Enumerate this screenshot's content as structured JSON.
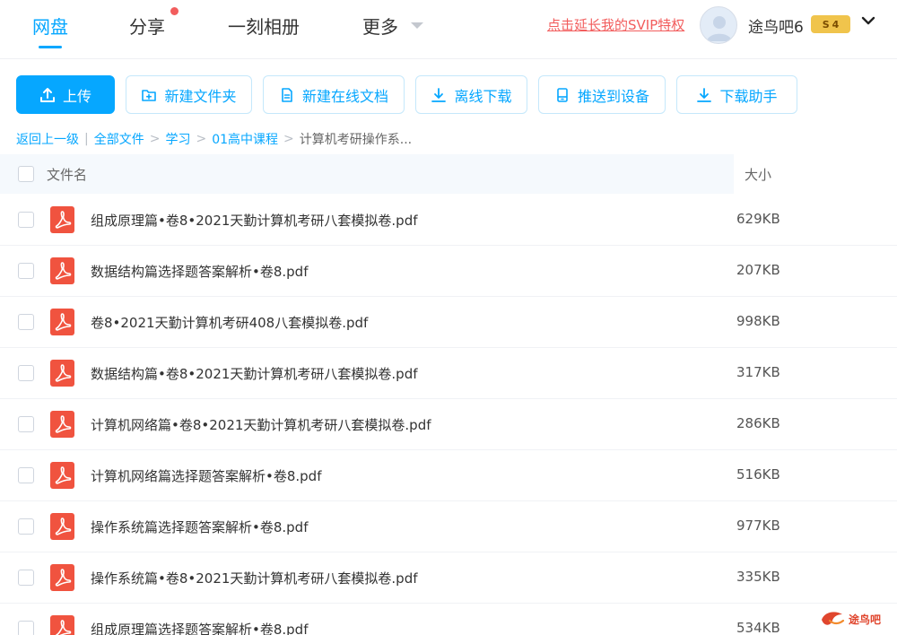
{
  "nav": {
    "items": [
      "网盘",
      "分享",
      "一刻相册",
      "更多"
    ],
    "svip_link": "点击延长我的SVIP特权",
    "username": "途鸟吧6",
    "vip_badge_letter": "S",
    "vip_level": "4"
  },
  "toolbar": {
    "upload": "上传",
    "new_folder": "新建文件夹",
    "new_doc": "新建在线文档",
    "offline_download": "离线下载",
    "push_device": "推送到设备",
    "download_helper": "下载助手"
  },
  "breadcrumb": {
    "back": "返回上一级",
    "all_files": "全部文件",
    "level1": "学习",
    "level2": "01高中课程",
    "current": "计算机考研操作系..."
  },
  "table": {
    "col_name": "文件名",
    "col_size": "大小",
    "rows": [
      {
        "name": "组成原理篇•卷8•2021天勤计算机考研八套模拟卷.pdf",
        "size": "629KB"
      },
      {
        "name": "数据结构篇选择题答案解析•卷8.pdf",
        "size": "207KB"
      },
      {
        "name": "卷8•2021天勤计算机考研408八套模拟卷.pdf",
        "size": "998KB"
      },
      {
        "name": "数据结构篇•卷8•2021天勤计算机考研八套模拟卷.pdf",
        "size": "317KB"
      },
      {
        "name": "计算机网络篇•卷8•2021天勤计算机考研八套模拟卷.pdf",
        "size": "286KB"
      },
      {
        "name": "计算机网络篇选择题答案解析•卷8.pdf",
        "size": "516KB"
      },
      {
        "name": "操作系统篇选择题答案解析•卷8.pdf",
        "size": "977KB"
      },
      {
        "name": "操作系统篇•卷8•2021天勤计算机考研八套模拟卷.pdf",
        "size": "335KB"
      },
      {
        "name": "组成原理篇选择题答案解析•卷8.pdf",
        "size": "534KB"
      }
    ]
  },
  "watermark": {
    "text": "途鸟吧"
  },
  "colors": {
    "accent": "#06a7ff",
    "pdf_red": "#f0533f",
    "svip_red": "#f25d5d",
    "vip_gold": "#f0c44c"
  }
}
